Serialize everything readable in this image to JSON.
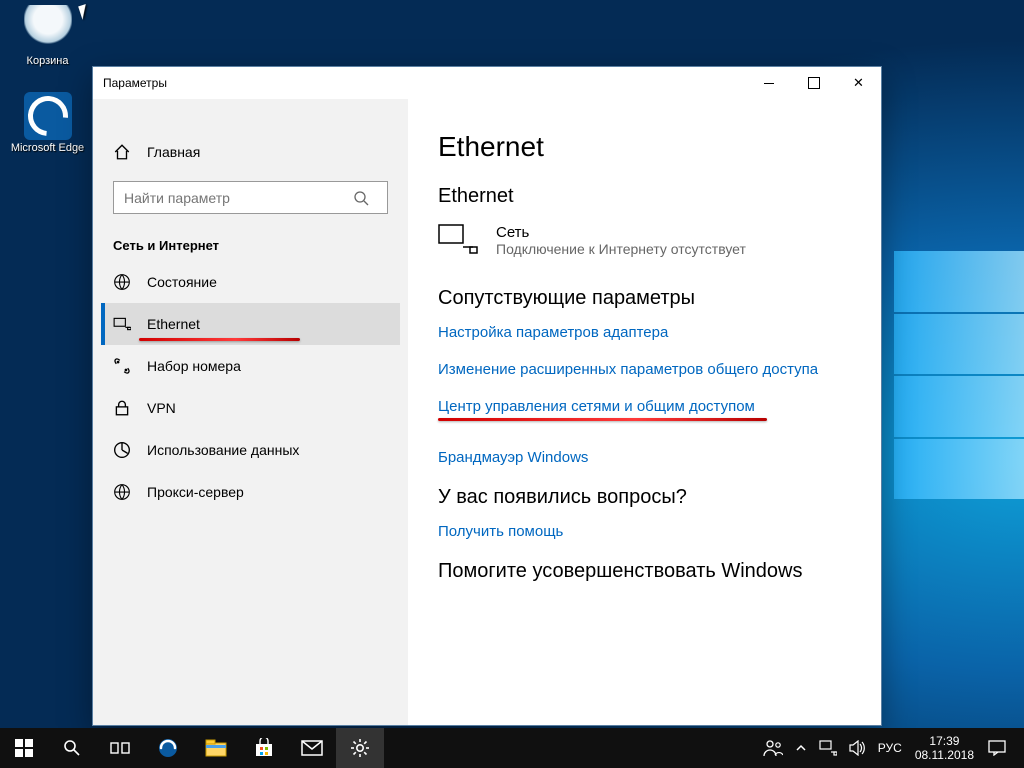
{
  "desktop": {
    "icons": [
      {
        "name": "recycle-bin",
        "label": "Корзина"
      },
      {
        "name": "edge",
        "label": "Microsoft Edge"
      }
    ]
  },
  "window": {
    "title": "Параметры"
  },
  "sidebar": {
    "home_label": "Главная",
    "search_placeholder": "Найти параметр",
    "section_label": "Сеть и Интернет",
    "items": [
      {
        "label": "Состояние",
        "icon": "status"
      },
      {
        "label": "Ethernet",
        "icon": "ethernet",
        "selected": true,
        "underline": true
      },
      {
        "label": "Набор номера",
        "icon": "dialup"
      },
      {
        "label": "VPN",
        "icon": "vpn"
      },
      {
        "label": "Использование данных",
        "icon": "data-usage"
      },
      {
        "label": "Прокси-сервер",
        "icon": "proxy"
      }
    ]
  },
  "content": {
    "page_title": "Ethernet",
    "subsection": "Ethernet",
    "network": {
      "name": "Сеть",
      "status": "Подключение к Интернету отсутствует"
    },
    "related": {
      "title": "Сопутствующие параметры",
      "links": [
        {
          "label": "Настройка параметров адаптера"
        },
        {
          "label": "Изменение расширенных параметров общего доступа"
        },
        {
          "label": "Центр управления сетями и общим доступом",
          "underline": true
        },
        {
          "label": "Брандмауэр Windows"
        }
      ]
    },
    "questions": {
      "title": "У вас появились вопросы?",
      "link": "Получить помощь"
    },
    "improve": {
      "title": "Помогите усовершенствовать Windows"
    }
  },
  "taskbar": {
    "lang": "РУС",
    "time": "17:39",
    "date": "08.11.2018"
  }
}
